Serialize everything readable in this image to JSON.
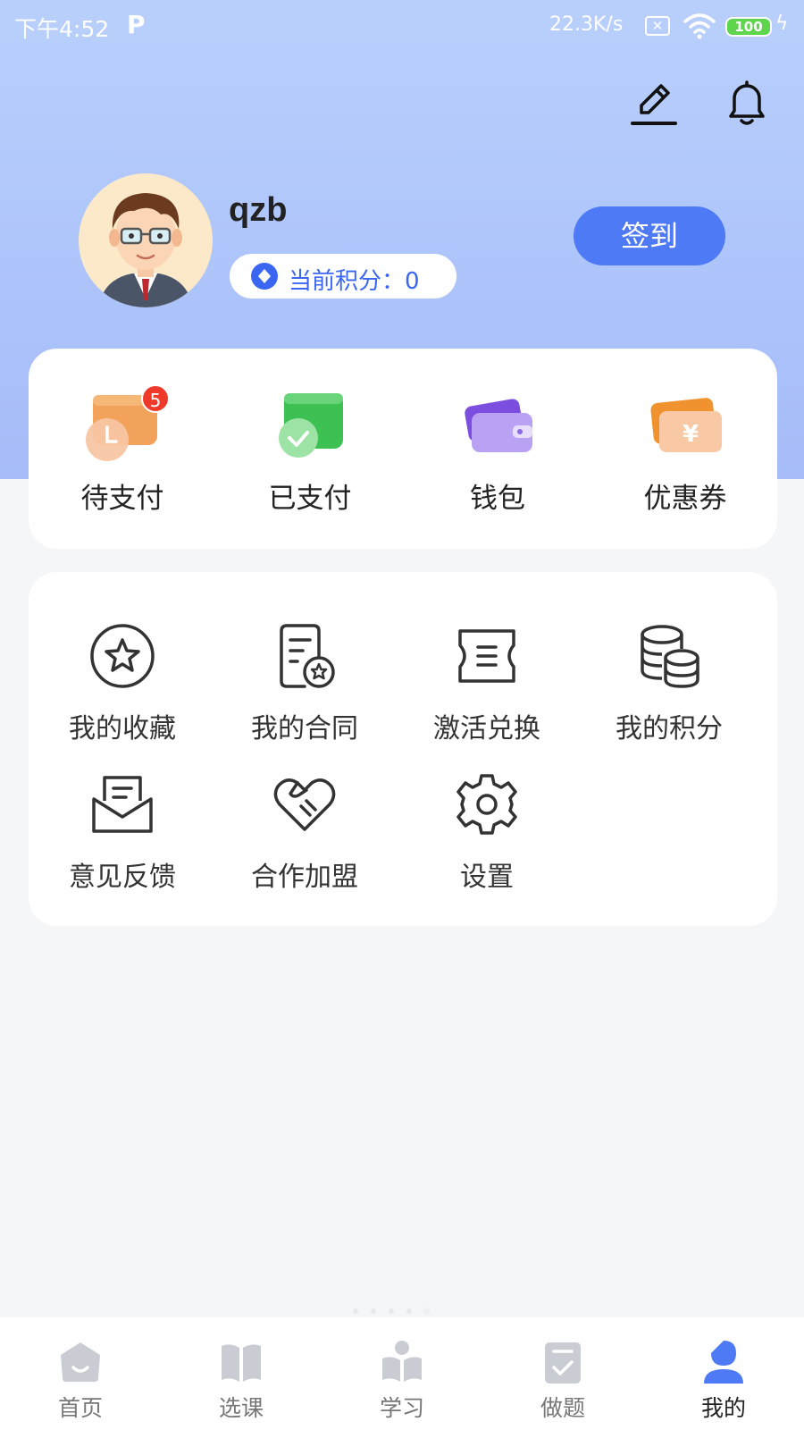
{
  "status_bar": {
    "time": "下午4:52",
    "app_indicator": "P",
    "net_speed": "22.3K/s",
    "battery": "100"
  },
  "header": {
    "edit_icon": "edit-icon",
    "bell_icon": "bell-icon"
  },
  "profile": {
    "username": "qzb",
    "points_label": "当前积分：0",
    "checkin_label": "签到"
  },
  "orders": [
    {
      "label": "待支付",
      "icon": "pending-payment-icon",
      "badge": "5"
    },
    {
      "label": "已支付",
      "icon": "paid-icon"
    },
    {
      "label": "钱包",
      "icon": "wallet-icon"
    },
    {
      "label": "优惠券",
      "icon": "coupon-icon"
    }
  ],
  "tools": [
    {
      "label": "我的收藏",
      "icon": "star-icon"
    },
    {
      "label": "我的合同",
      "icon": "contract-icon"
    },
    {
      "label": "激活兑换",
      "icon": "ticket-icon"
    },
    {
      "label": "我的积分",
      "icon": "coins-icon"
    },
    {
      "label": "意见反馈",
      "icon": "feedback-icon"
    },
    {
      "label": "合作加盟",
      "icon": "handshake-heart-icon"
    },
    {
      "label": "设置",
      "icon": "gear-icon"
    }
  ],
  "tabs": [
    {
      "label": "首页",
      "icon": "home-icon"
    },
    {
      "label": "选课",
      "icon": "book-icon"
    },
    {
      "label": "学习",
      "icon": "reading-icon"
    },
    {
      "label": "做题",
      "icon": "exercise-icon"
    },
    {
      "label": "我的",
      "icon": "user-icon",
      "active": true
    }
  ],
  "colors": {
    "accent": "#4f7af5",
    "hero_top": "#b9cffb",
    "badge": "#ef3a2b",
    "background": "#f5f6f8"
  }
}
